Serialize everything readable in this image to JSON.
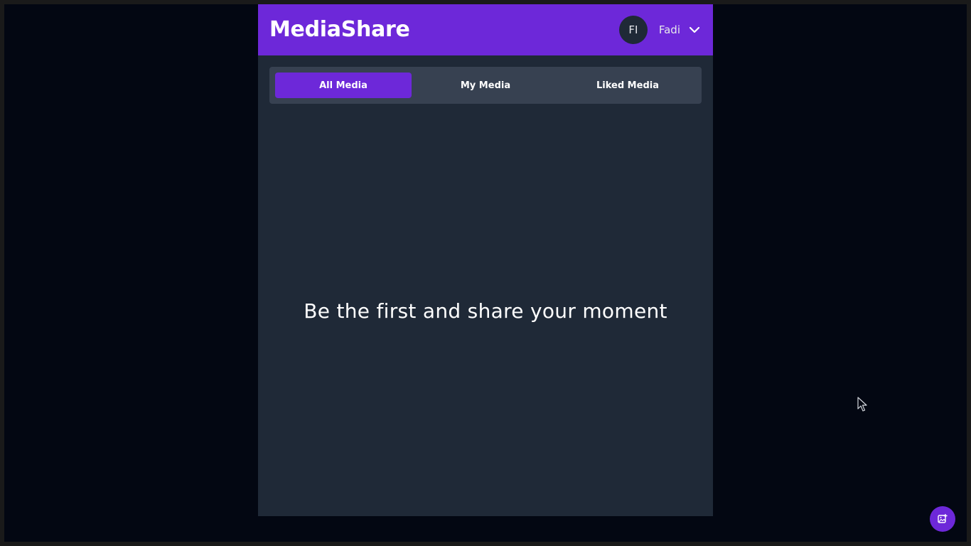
{
  "app": {
    "brand": "MediaShare"
  },
  "user": {
    "initials": "FI",
    "name": "Fadi"
  },
  "tabs": [
    {
      "label": "All Media",
      "active": true
    },
    {
      "label": "My Media",
      "active": false
    },
    {
      "label": "Liked Media",
      "active": false
    }
  ],
  "main": {
    "empty_message": "Be the first and share your moment"
  },
  "icons": {
    "user_menu_toggle": "chevron-down-icon",
    "upload_button": "image-plus-icon",
    "mouse_pointer": "cursor-icon"
  },
  "colors": {
    "accent": "#6d28d9",
    "app_background": "#1f2937",
    "tabs_background": "#374151",
    "screen_background": "#030712"
  }
}
